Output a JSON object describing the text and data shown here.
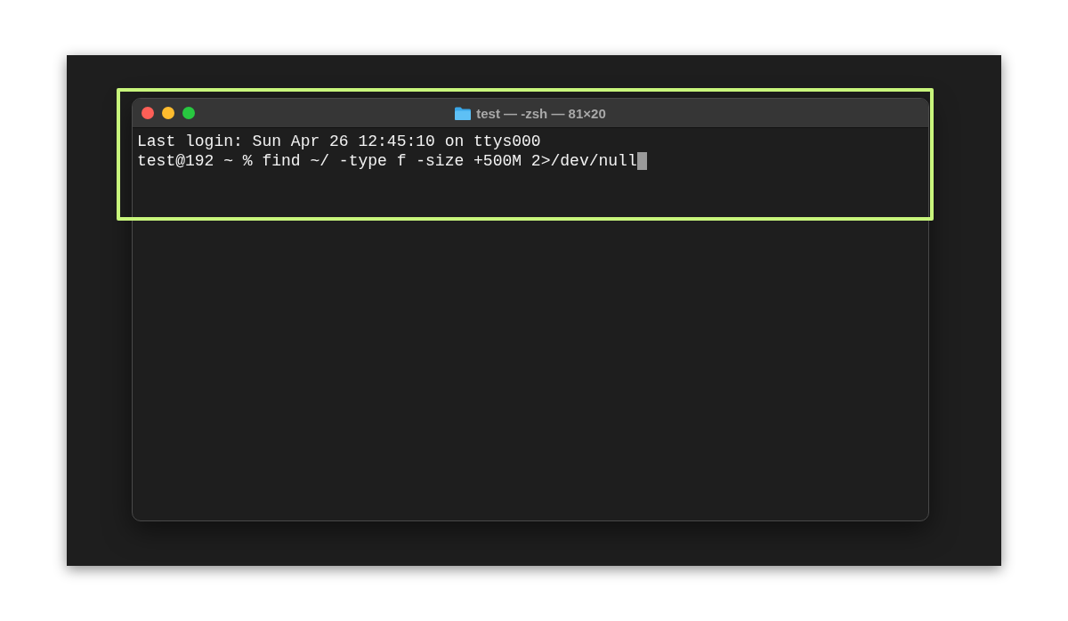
{
  "window": {
    "title": "test — -zsh — 81×20"
  },
  "terminal": {
    "lines": [
      {
        "text": "Last login: Sun Apr 26 12:45:10 on ttys000",
        "cursor": false
      },
      {
        "text": "test@192 ~ % find ~/ -type f -size +500M 2>/dev/null",
        "cursor": true
      }
    ]
  }
}
